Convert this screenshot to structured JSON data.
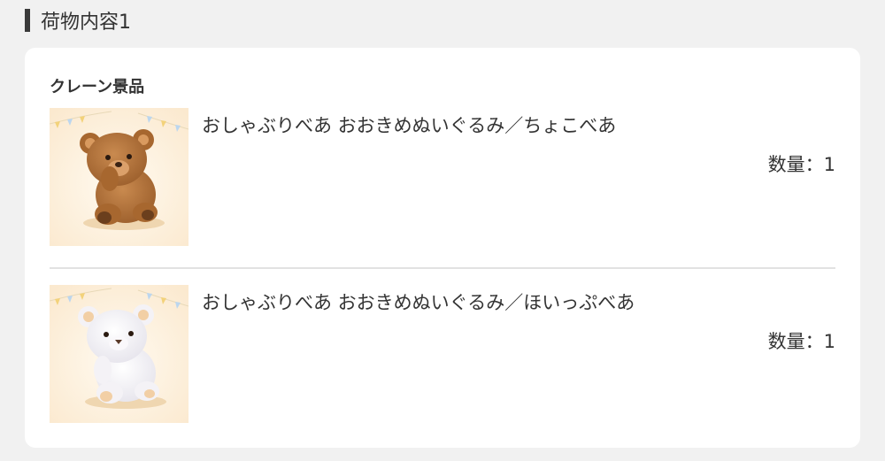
{
  "section": {
    "title": "荷物内容1"
  },
  "card": {
    "category": "クレーン景品",
    "items": [
      {
        "name": "おしゃぶりべあ おおきめぬいぐるみ／ちょこべあ",
        "quantity_label": "数量：1",
        "image_icon": "brown-teddy-bear-image"
      },
      {
        "name": "おしゃぶりべあ おおきめぬいぐるみ／ほいっぷべあ",
        "quantity_label": "数量：1",
        "image_icon": "white-teddy-bear-image"
      }
    ]
  }
}
